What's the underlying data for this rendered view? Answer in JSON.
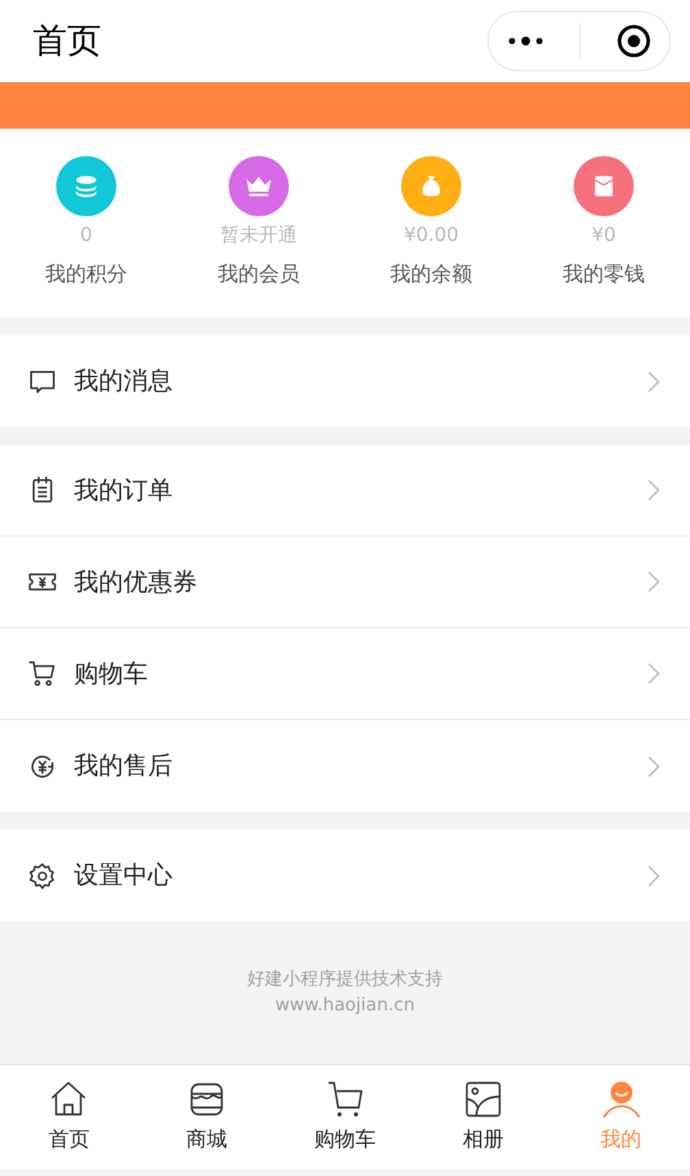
{
  "header": {
    "title": "首页"
  },
  "stats": [
    {
      "kind": "coins",
      "color": "#10c8d8",
      "value": "0",
      "label": "我的积分"
    },
    {
      "kind": "crown",
      "color": "#d66ae6",
      "value": "暂未开通",
      "label": "我的会员"
    },
    {
      "kind": "moneybag",
      "color": "#ffae14",
      "value": "¥0.00",
      "label": "我的余额"
    },
    {
      "kind": "envelope",
      "color": "#f7707e",
      "value": "¥0",
      "label": "我的零钱"
    }
  ],
  "menu_groups": [
    [
      {
        "kind": "message",
        "label": "我的消息"
      }
    ],
    [
      {
        "kind": "order",
        "label": "我的订单"
      },
      {
        "kind": "coupon",
        "label": "我的优惠券"
      },
      {
        "kind": "cart",
        "label": "购物车"
      },
      {
        "kind": "aftersale",
        "label": "我的售后"
      }
    ],
    [
      {
        "kind": "settings",
        "label": "设置中心"
      }
    ]
  ],
  "footer": {
    "line_1": "好建小程序提供技术支持",
    "line_2": "www.haojian.cn"
  },
  "tab_bar": [
    {
      "kind": "home",
      "label": "首页",
      "selected": false
    },
    {
      "kind": "shop",
      "label": "商城",
      "selected": false
    },
    {
      "kind": "cart",
      "label": "购物车",
      "selected": false
    },
    {
      "kind": "album",
      "label": "相册",
      "selected": false
    },
    {
      "kind": "person",
      "label": "我的",
      "selected": true
    }
  ]
}
